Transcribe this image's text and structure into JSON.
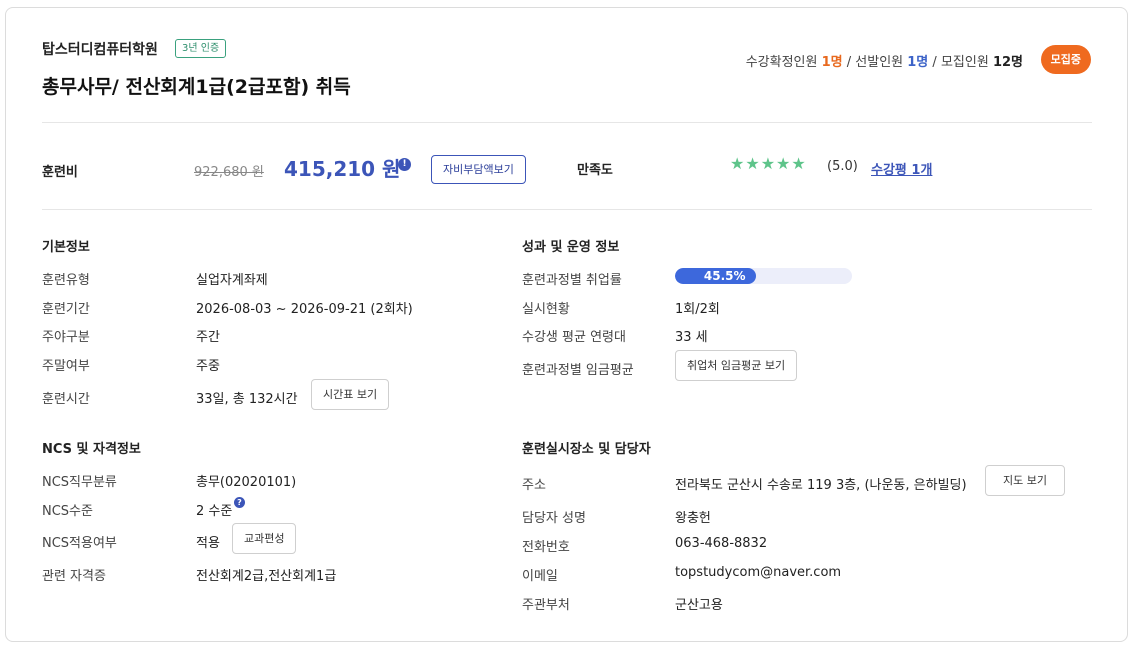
{
  "header": {
    "org_name": "탑스터디컴퓨터학원",
    "cert_badge": "3년 인증",
    "course_title": "총무사무/ 전산회계1급(2급포함) 취득",
    "counts": {
      "confirmed_label": "수강확정인원",
      "confirmed_value": "1명",
      "selected_label": "선발인원",
      "selected_value": "1명",
      "recruit_label": "모집인원",
      "recruit_value": "12명",
      "separator": "/"
    },
    "status_badge": "모집중",
    "colors": {
      "orange": "#ef6a1f",
      "blue": "#3c55b8",
      "green": "#5ec48a"
    }
  },
  "fee": {
    "label": "훈련비",
    "original_price": "922,680 원",
    "price": "415,210 원",
    "info_icon": "info-icon",
    "self_pay_button": "자비부담액보기"
  },
  "satisfaction": {
    "label": "만족도",
    "stars": "★★★★★",
    "star_count": 5,
    "score": "(5.0)",
    "review_link": "수강평 1개"
  },
  "basic_info": {
    "title": "기본정보",
    "rows": [
      {
        "label": "훈련유형",
        "value": "실업자계좌제"
      },
      {
        "label": "훈련기간",
        "value": "2026-08-03 ~ 2026-09-21 (2회차)"
      },
      {
        "label": "주야구분",
        "value": "주간"
      },
      {
        "label": "주말여부",
        "value": "주중"
      },
      {
        "label": "훈련시간",
        "value": "33일, 총 132시간",
        "button": "시간표 보기"
      }
    ]
  },
  "performance": {
    "title": "성과 및 운영 정보",
    "rows": [
      {
        "label": "훈련과정별 취업률",
        "progress_text": "45.5%",
        "progress_value": 45.5
      },
      {
        "label": "실시현황",
        "value": "1회/2회"
      },
      {
        "label": "수강생 평균 연령대",
        "value": "33 세"
      },
      {
        "label": "훈련과정별 임금평균",
        "button": "취업처 임금평균 보기"
      }
    ]
  },
  "ncs": {
    "title": "NCS 및 자격정보",
    "rows": [
      {
        "label": "NCS직무분류",
        "value": "총무(02020101)"
      },
      {
        "label": "NCS수준",
        "value": "2 수준"
      },
      {
        "label": "NCS적용여부",
        "value": "적용",
        "button": "교과편성"
      },
      {
        "label": "관련 자격증",
        "value": "전산회계2급,전산회계1급"
      }
    ]
  },
  "location": {
    "title": "훈련실시장소 및 담당자",
    "rows": [
      {
        "label": "주소",
        "value": "전라북도 군산시 수송로 119 3층, (나운동, 은하빌딩)",
        "button": "지도 보기"
      },
      {
        "label": "담당자 성명",
        "value": "왕충헌"
      },
      {
        "label": "전화번호",
        "value": "063-468-8832"
      },
      {
        "label": "이메일",
        "value": "topstudycom@naver.com"
      },
      {
        "label": "주관부처",
        "value": "군산고용"
      }
    ]
  }
}
